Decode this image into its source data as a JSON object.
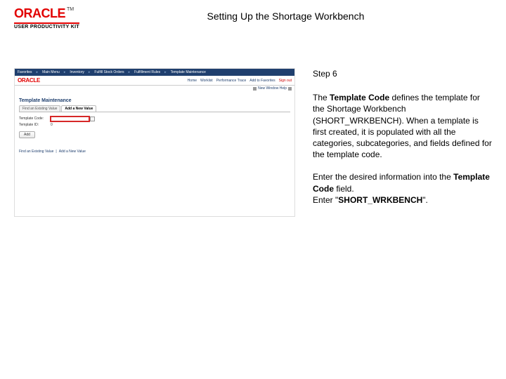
{
  "header": {
    "brand": "ORACLE",
    "tm": "TM",
    "product_line": "USER PRODUCTIVITY KIT",
    "title": "Setting Up the Shortage Workbench"
  },
  "app": {
    "breadcrumb": [
      "Favorites",
      "Main Menu",
      "Inventory",
      "Fulfill Stock Orders",
      "Fulfillment Rules",
      "Template Maintenance"
    ],
    "brand": "ORACLE",
    "nav": [
      "Home",
      "Worklist",
      "Performance Trace",
      "Add to Favorites"
    ],
    "signout": "Sign out",
    "subrow_label": "New Window   Help",
    "section_title": "Template Maintenance",
    "tabs": [
      {
        "label": "Find an Existing Value",
        "active": false
      },
      {
        "label": "Add a New Value",
        "active": true
      }
    ],
    "fields": {
      "template_code_label": "Template Code:",
      "template_id_label": "Template ID:",
      "template_id_value": "0"
    },
    "add_button": "Add",
    "footer": [
      "Find an Existing Value",
      "|",
      "Add a New Value"
    ]
  },
  "instruction": {
    "step": "Step 6",
    "p1_a": "The ",
    "p1_b": "Template Code",
    "p1_c": " defines the template for the Shortage Workbench (SHORT_WRKBENCH). When a template is first created, it is populated with all the categories, subcategories, and fields defined for the template code.",
    "p2_a": "Enter the desired information into the ",
    "p2_b": "Template Code",
    "p2_c": " field.",
    "p3_a": "Enter \"",
    "p3_b": "SHORT_WRKBENCH",
    "p3_c": "\"."
  }
}
